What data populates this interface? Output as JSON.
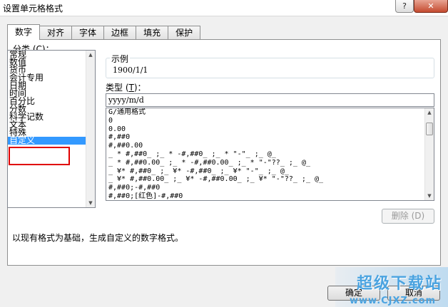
{
  "window": {
    "title": "设置单元格格式",
    "help_label": "?",
    "close_label": "✕"
  },
  "tabs": [
    {
      "label": "数字",
      "active": true
    },
    {
      "label": "对齐"
    },
    {
      "label": "字体"
    },
    {
      "label": "边框"
    },
    {
      "label": "填充"
    },
    {
      "label": "保护"
    }
  ],
  "category": {
    "label_prefix": "分类 (",
    "label_key": "C",
    "label_suffix": ")：",
    "items": [
      "常规",
      "数值",
      "货币",
      "会计专用",
      "日期",
      "时间",
      "百分比",
      "分数",
      "科学记数",
      "文本",
      "特殊",
      "自定义"
    ],
    "selected": "自定义"
  },
  "example": {
    "title": "示例",
    "value": "1900/1/1"
  },
  "type": {
    "label_prefix": "类型 (",
    "label_key": "T",
    "label_suffix": ")：",
    "value": "yyyy/m/d",
    "formats": [
      "G/通用格式",
      "0",
      "0.00",
      "#,##0",
      "#,##0.00",
      "_ * #,##0_ ;_ * -#,##0_ ;_ * \"-\"_ ;_ @_",
      "_ * #,##0.00_ ;_ * -#,##0.00_ ;_ * \"-\"??_ ;_ @_",
      "_ ¥* #,##0_ ;_ ¥* -#,##0_ ;_ ¥* \"-\"_ ;_ @_",
      "_ ¥* #,##0.00_ ;_ ¥* -#,##0.00_ ;_ ¥* \"-\"??_ ;_ @_",
      "#,##0;-#,##0",
      "#,##0;[红色]-#,##0"
    ]
  },
  "delete_button": "删除 (D)",
  "description": "以现有格式为基础，生成自定义的数字格式。",
  "ok_button": "确定",
  "cancel_button": "取消",
  "watermark": {
    "main": "超级下载站",
    "url": "www.CJXZ.com"
  }
}
